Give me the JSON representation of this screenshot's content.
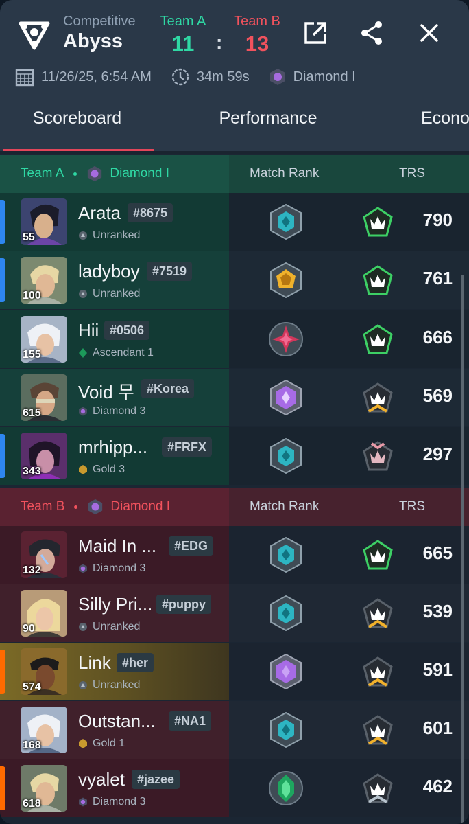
{
  "header": {
    "mode": "Competitive",
    "map": "Abyss",
    "team_a": {
      "name": "Team A",
      "score": "11"
    },
    "team_b": {
      "name": "Team B",
      "score": "13"
    },
    "colon": ":",
    "date": "11/26/25, 6:54 AM",
    "duration": "34m 59s",
    "avg_rank": "Diamond I",
    "icons": {
      "logo": "triangle-logo-icon",
      "open": "open-external-icon",
      "share": "share-icon",
      "close": "close-icon"
    }
  },
  "tabs": [
    "Scoreboard",
    "Performance",
    "Econo"
  ],
  "sections": {
    "team_a": {
      "name": "Team A",
      "rank": "Diamond I",
      "col_match_rank": "Match Rank",
      "col_trs": "TRS"
    },
    "team_b": {
      "name": "Team B",
      "rank": "Diamond I",
      "col_match_rank": "Match Rank",
      "col_trs": "TRS"
    }
  },
  "colors": {
    "team_a": "#2fd8a4",
    "team_b": "#f1525d",
    "tab_underline": "#e2465a",
    "accent_blue": "#2e86f0",
    "accent_orange": "#ff6a00"
  },
  "players_a": [
    {
      "name": "Arata",
      "tag": "#8675",
      "level": "55",
      "rank": "Unranked",
      "match_rank_icon": "platinum-icon",
      "trs_icon": "trs-green-icon",
      "trs": "790"
    },
    {
      "name": "ladyboy",
      "tag": "#7519",
      "level": "100",
      "rank": "Unranked",
      "match_rank_icon": "gold-icon",
      "trs_icon": "trs-green-icon",
      "trs": "761"
    },
    {
      "name": "Hii",
      "tag": "#0506",
      "level": "155",
      "rank": "Ascendant 1",
      "match_rank_icon": "immortal-icon",
      "trs_icon": "trs-green-icon",
      "trs": "666"
    },
    {
      "name": "Void 무",
      "tag": "#Korea",
      "level": "615",
      "rank": "Diamond 3",
      "match_rank_icon": "diamond-icon",
      "trs_icon": "trs-gold-icon",
      "trs": "569"
    },
    {
      "name": "mrhipp...",
      "tag": "#FRFX",
      "level": "343",
      "rank": "Gold 3",
      "match_rank_icon": "platinum-icon",
      "trs_icon": "trs-pink-icon",
      "trs": "297"
    }
  ],
  "players_b": [
    {
      "name": "Maid In ...",
      "tag": "#EDG",
      "level": "132",
      "rank": "Diamond 3",
      "match_rank_icon": "platinum-icon",
      "trs_icon": "trs-green-icon",
      "trs": "665"
    },
    {
      "name": "Silly Pri...",
      "tag": "#puppy",
      "level": "90",
      "rank": "Unranked",
      "match_rank_icon": "platinum-icon",
      "trs_icon": "trs-gold-icon",
      "trs": "539"
    },
    {
      "name": "Link",
      "tag": "#her",
      "level": "574",
      "rank": "Unranked",
      "match_rank_icon": "diamond-icon",
      "trs_icon": "trs-gold-icon",
      "trs": "591"
    },
    {
      "name": "Outstan...",
      "tag": "#NA1",
      "level": "168",
      "rank": "Gold 1",
      "match_rank_icon": "platinum-icon",
      "trs_icon": "trs-gold-icon",
      "trs": "601"
    },
    {
      "name": "vyalet",
      "tag": "#jazee",
      "level": "618",
      "rank": "Diamond 3",
      "match_rank_icon": "ascendant-icon",
      "trs_icon": "trs-silver-icon",
      "trs": "462"
    }
  ]
}
